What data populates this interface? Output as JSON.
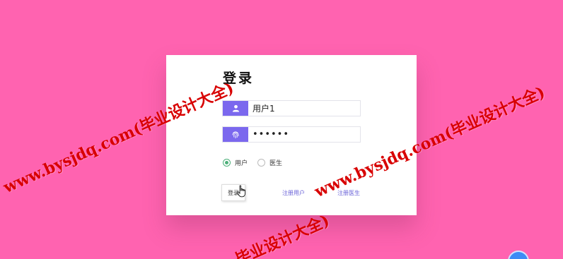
{
  "colors": {
    "background": "#ff63b0",
    "accent": "#7b68ee",
    "radio_checked": "#4caf79",
    "link": "#6a63d8",
    "watermark": "#d80000"
  },
  "login_form": {
    "title": "登录",
    "username": {
      "icon": "user-icon",
      "value": "用户1"
    },
    "password": {
      "icon": "fingerprint-icon",
      "value": "••••••"
    },
    "roles": [
      {
        "label": "用户",
        "selected": true
      },
      {
        "label": "医生",
        "selected": false
      }
    ],
    "login_button_label": "登录",
    "register_user_link": "注册用户",
    "register_doctor_link": "注册医生"
  },
  "watermarks": [
    "www.bysjdq.com(毕业设计大全)",
    "www.bysjdq.com(毕业设计大全)",
    "毕业设计大全)"
  ]
}
